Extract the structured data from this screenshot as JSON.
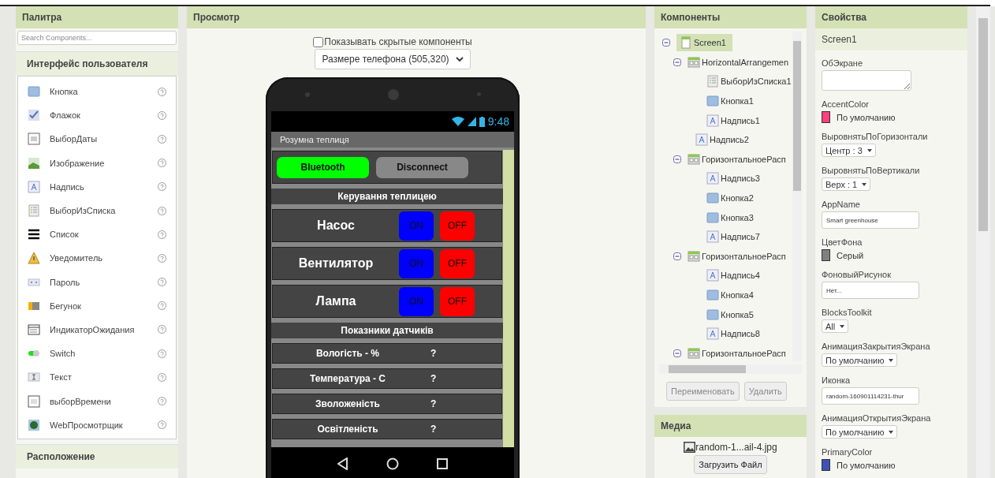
{
  "palette": {
    "title": "Палитра",
    "search": {
      "placeholder": "Search Components..."
    },
    "sections": [
      {
        "title": "Интерфейс пользователя",
        "expanded": true,
        "items": [
          {
            "label": "Кнопка",
            "kind": "button"
          },
          {
            "label": "Флажок",
            "kind": "checkbox"
          },
          {
            "label": "ВыборДаты",
            "kind": "date"
          },
          {
            "label": "Изображение",
            "kind": "image"
          },
          {
            "label": "Надпись",
            "kind": "label"
          },
          {
            "label": "ВыборИзСписка",
            "kind": "listpicker"
          },
          {
            "label": "Список",
            "kind": "list"
          },
          {
            "label": "Уведомитель",
            "kind": "notifier"
          },
          {
            "label": "Пароль",
            "kind": "password"
          },
          {
            "label": "Бегунок",
            "kind": "slider"
          },
          {
            "label": "ИндикаторОжидания",
            "kind": "spinner"
          },
          {
            "label": "Switch",
            "kind": "switch"
          },
          {
            "label": "Текст",
            "kind": "textbox"
          },
          {
            "label": "выборВремени",
            "kind": "time"
          },
          {
            "label": "WebПросмотрщик",
            "kind": "web"
          }
        ]
      },
      {
        "title": "Расположение",
        "expanded": false
      }
    ]
  },
  "preview": {
    "title": "Просмотр",
    "show_hidden": {
      "label": "Показывать скрытые компоненты",
      "checked": false
    },
    "size_select": "Размере телефона (505,320)",
    "phone": {
      "clock": "9:48",
      "app_title": "Розумна теплиця",
      "rows": [
        {
          "kind": "buttons",
          "buttons": [
            {
              "label": "Bluetooth",
              "color": "#00ff00"
            },
            {
              "label": "Disconnect",
              "color": "#888888"
            }
          ]
        },
        {
          "kind": "heading",
          "text": "Керування теплицею"
        },
        {
          "kind": "device",
          "name": "Насос",
          "on": "ON",
          "off": "OFF"
        },
        {
          "kind": "device",
          "name": "Вентилятор",
          "on": "ON",
          "off": "OFF"
        },
        {
          "kind": "device",
          "name": "Лампа",
          "on": "ON",
          "off": "OFF"
        },
        {
          "kind": "heading",
          "text": "Показники датчиків"
        },
        {
          "kind": "sensor",
          "label": "Вологість - %",
          "value": "?"
        },
        {
          "kind": "sensor",
          "label": "Температура - С",
          "value": "?"
        },
        {
          "kind": "sensor",
          "label": "Зволоженість",
          "value": "?"
        },
        {
          "kind": "sensor",
          "label": "Освітленість",
          "value": "?"
        }
      ]
    }
  },
  "components": {
    "title": "Компоненты",
    "tree": [
      {
        "label": "Screen1",
        "kind": "screen",
        "selected": true,
        "expanded": true,
        "children": [
          {
            "label": "HorizontalArrangemen",
            "kind": "arrangement",
            "selected": false,
            "expanded": true,
            "children": [
              {
                "label": "ВыборИзСписка1",
                "kind": "listpicker",
                "selected": false
              },
              {
                "label": "Кнопка1",
                "kind": "button",
                "selected": false
              },
              {
                "label": "Надпись1",
                "kind": "label",
                "selected": false
              }
            ]
          },
          {
            "label": "Надпись2",
            "kind": "label",
            "selected": false
          },
          {
            "label": "ГоризонтальноеРасп",
            "kind": "arrangement",
            "selected": false,
            "expanded": true,
            "children": [
              {
                "label": "Надпись3",
                "kind": "label",
                "selected": false
              },
              {
                "label": "Кнопка2",
                "kind": "button",
                "selected": false
              },
              {
                "label": "Кнопка3",
                "kind": "button",
                "selected": false
              },
              {
                "label": "Надпись7",
                "kind": "label",
                "selected": false
              }
            ]
          },
          {
            "label": "ГоризонтальноеРасп",
            "kind": "arrangement",
            "selected": false,
            "expanded": true,
            "children": [
              {
                "label": "Надпись4",
                "kind": "label",
                "selected": false
              },
              {
                "label": "Кнопка4",
                "kind": "button",
                "selected": false
              },
              {
                "label": "Кнопка5",
                "kind": "button",
                "selected": false
              },
              {
                "label": "Надпись8",
                "kind": "label",
                "selected": false
              }
            ]
          },
          {
            "label": "ГоризонтальноеРасп",
            "kind": "arrangement",
            "selected": false,
            "expanded": true
          }
        ]
      }
    ],
    "buttons": [
      {
        "label": "Переименовать",
        "disabled": true
      },
      {
        "label": "Удалить",
        "disabled": true
      }
    ]
  },
  "media": {
    "title": "Медиа",
    "files": [
      "random-1...ail-4.jpg"
    ],
    "upload": "Загрузить Файл"
  },
  "properties": {
    "title": "Свойства",
    "component": "Screen1",
    "items": [
      {
        "kind": "textarea",
        "label": "ОбЭкране"
      },
      {
        "kind": "color",
        "label": "AccentColor",
        "value": "По умолчанию",
        "color": "#ff4081"
      },
      {
        "kind": "select",
        "label": "ВыровнятьПоГоризонтали",
        "value": "Центр : 3"
      },
      {
        "kind": "select",
        "label": "ВыровнятьПоВертикали",
        "value": "Верх : 1"
      },
      {
        "kind": "text",
        "label": "AppName",
        "value": "Smart greenhouse"
      },
      {
        "kind": "color",
        "label": "ЦветФона",
        "value": "Серый",
        "color": "#808080"
      },
      {
        "kind": "text",
        "label": "ФоновыйРисунок",
        "value": "Нет..."
      },
      {
        "kind": "select",
        "label": "BlocksToolkit",
        "value": "All"
      },
      {
        "kind": "select",
        "label": "АнимацияЗакрытияЭкрана",
        "value": "По умолчанию"
      },
      {
        "kind": "text",
        "label": "Иконка",
        "value": "random-160901114231-thur"
      },
      {
        "kind": "select",
        "label": "АнимацияОткрытияЭкрана",
        "value": "По умолчанию"
      },
      {
        "kind": "color",
        "label": "PrimaryColor",
        "value": "По умолчанию",
        "color": "#3f51b5"
      }
    ]
  }
}
